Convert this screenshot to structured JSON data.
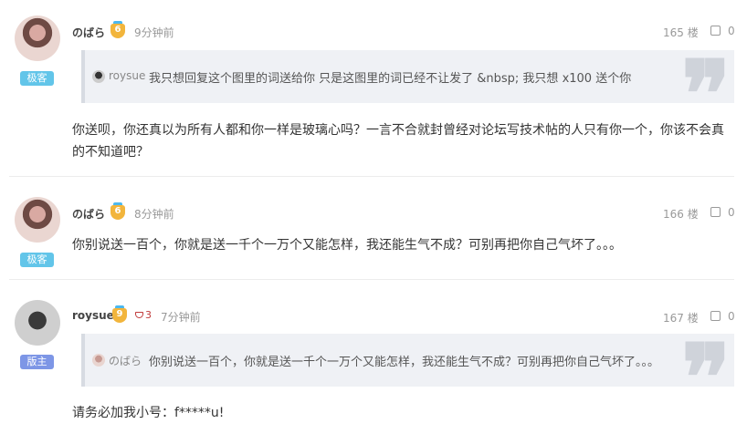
{
  "posts": [
    {
      "username": "のばら",
      "level": "6",
      "time": "9分钟前",
      "floor": "165 楼",
      "likes": "0",
      "role": "极客",
      "quote": {
        "user": "roysue",
        "text": "我只想回复这个图里的词送给你 只是这图里的词已经不让发了 &nbsp; 我只想 x100 送个你"
      },
      "content": "你送呗，你还真以为所有人都和你一样是玻璃心吗？一言不合就封曾经对论坛写技术帖的人只有你一个，你该不会真的不知道吧？"
    },
    {
      "username": "のばら",
      "level": "6",
      "time": "8分钟前",
      "floor": "166 楼",
      "likes": "0",
      "role": "极客",
      "content": "你别说送一百个，你就是送一千个一万个又能怎样，我还能生气不成？可别再把你自己气坏了。。。"
    },
    {
      "username": "roysue",
      "level": "9",
      "gem_count": "3",
      "time": "7分钟前",
      "floor": "167 楼",
      "likes": "0",
      "role": "版主",
      "quote": {
        "user": "のばら",
        "text": "你别说送一百个，你就是送一千个一万个又能怎样，我还能生气不成？可别再把你自己气坏了。。。"
      },
      "content": "请务必加我小号：f*****u!"
    }
  ],
  "colors": {
    "guest_badge": "#62c5e9",
    "mod_badge": "#7d96e6",
    "level_badge": "#f2b53c",
    "gem": "#c03a3a"
  },
  "icons": [
    "thumbs-up-icon",
    "level-badge-icon",
    "gem-icon",
    "quote-mark-icon"
  ]
}
